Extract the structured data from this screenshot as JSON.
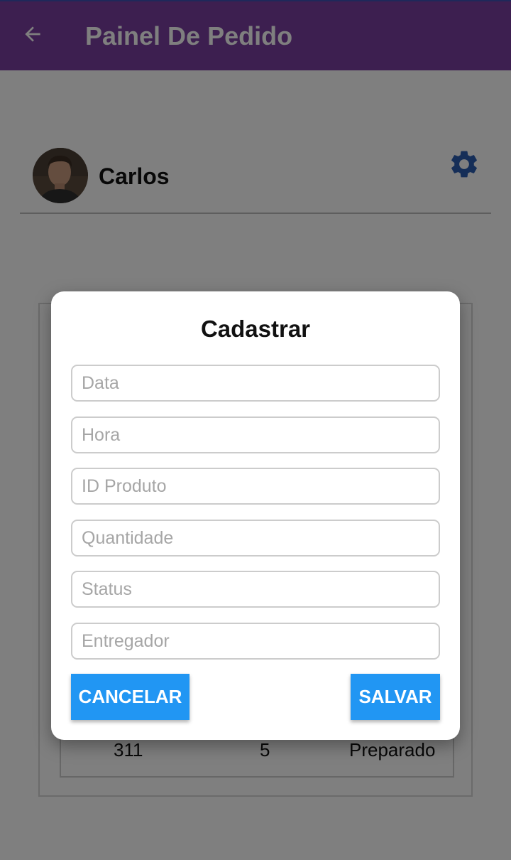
{
  "appbar": {
    "title": "Painel De Pedido",
    "back_icon": "arrow-left-icon",
    "color": "#7b3fa0"
  },
  "profile": {
    "name": "Carlos",
    "settings_icon": "gear-icon",
    "settings_color": "#2a5db0"
  },
  "table": {
    "row": {
      "id": "311",
      "quantity": "5",
      "status": "Preparado"
    }
  },
  "dialog": {
    "title": "Cadastrar",
    "fields": {
      "data": {
        "placeholder": "Data",
        "value": ""
      },
      "hora": {
        "placeholder": "Hora",
        "value": ""
      },
      "id_produto": {
        "placeholder": "ID Produto",
        "value": ""
      },
      "quantidade": {
        "placeholder": "Quantidade",
        "value": ""
      },
      "status": {
        "placeholder": "Status",
        "value": ""
      },
      "entregador": {
        "placeholder": "Entregador",
        "value": ""
      }
    },
    "cancel_label": "CANCELAR",
    "save_label": "SALVAR",
    "button_color": "#2196f3"
  }
}
